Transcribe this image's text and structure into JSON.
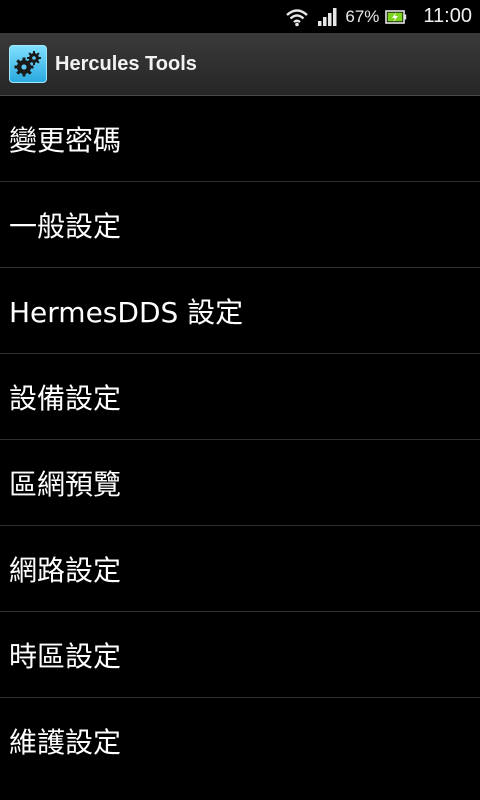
{
  "status_bar": {
    "battery_percent": "67%",
    "time": "11:00",
    "icons": [
      "wifi-icon",
      "signal-icon",
      "battery-charging-icon"
    ]
  },
  "action_bar": {
    "app_icon": "gears-icon",
    "title": "Hercules Tools"
  },
  "menu": {
    "items": [
      {
        "label": "變更密碼"
      },
      {
        "label": "一般設定"
      },
      {
        "label": "HermesDDS 設定"
      },
      {
        "label": "設備設定"
      },
      {
        "label": "區網預覽"
      },
      {
        "label": "網路設定"
      },
      {
        "label": "時區設定"
      },
      {
        "label": "維護設定"
      }
    ]
  },
  "colors": {
    "background": "#000000",
    "action_bar": "#333333",
    "divider": "#2e2e2e",
    "app_icon_accent": "#2aa9e0",
    "battery_charge": "#7ed321"
  }
}
